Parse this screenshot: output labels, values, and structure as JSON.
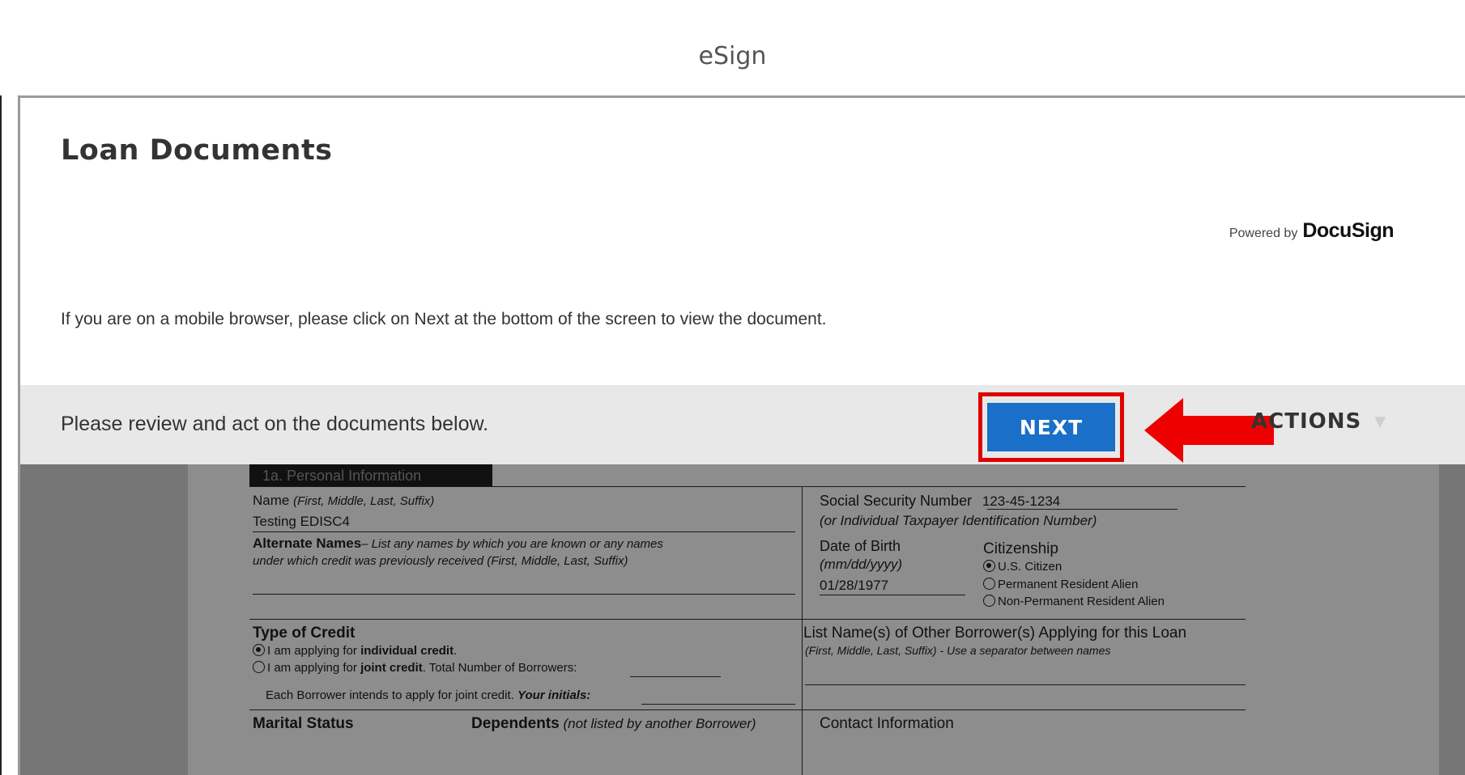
{
  "window": {
    "title": "eSign"
  },
  "panel": {
    "title": "Loan Documents",
    "powered_by": "Powered by",
    "brand": "DocuSign",
    "mobile_note": "If you are on a mobile browser, please click on Next at the bottom of the screen to view the document."
  },
  "action_bar": {
    "message": "Please review and act on the documents below.",
    "next_label": "NEXT",
    "other_actions_label": "ACTIONS"
  },
  "document": {
    "section_tab": "1a. Personal Information",
    "name_label": "Name",
    "name_hint": "(First, Middle, Last, Suffix)",
    "name_value": "Testing EDISC4",
    "alt_names_label": "Alternate Names",
    "alt_names_hint_1": "– List any names by which you are known or any names",
    "alt_names_hint_2": "under which credit was previously received (First, Middle, Last, Suffix)",
    "ssn_label": "Social Security Number",
    "ssn_value": "123-45-1234",
    "ssn_hint": "(or Individual Taxpayer Identification Number)",
    "dob_label": "Date of Birth",
    "dob_hint": "(mm/dd/yyyy)",
    "dob_value": "01/28/1977",
    "citizenship_label": "Citizenship",
    "citizenship_options": [
      "U.S. Citizen",
      "Permanent Resident Alien",
      "Non-Permanent Resident Alien"
    ],
    "type_credit_label": "Type of Credit",
    "credit_opt1_pre": "I am applying for ",
    "credit_opt1_bold": "individual credit",
    "credit_opt2_pre": "I am applying for ",
    "credit_opt2_bold": "joint credit",
    "credit_opt2_post": ". Total Number of Borrowers:",
    "initials_text": "Each Borrower intends to apply for joint credit.",
    "initials_label": "Your initials:",
    "other_borrowers_label": "List Name(s) of Other Borrower(s) Applying for this Loan",
    "other_borrowers_hint": "(First, Middle, Last, Suffix) - Use a separator between names",
    "marital_label": "Marital Status",
    "dependents_label": "Dependents",
    "dependents_hint": "(not listed by another Borrower)",
    "contact_label": "Contact Information"
  }
}
